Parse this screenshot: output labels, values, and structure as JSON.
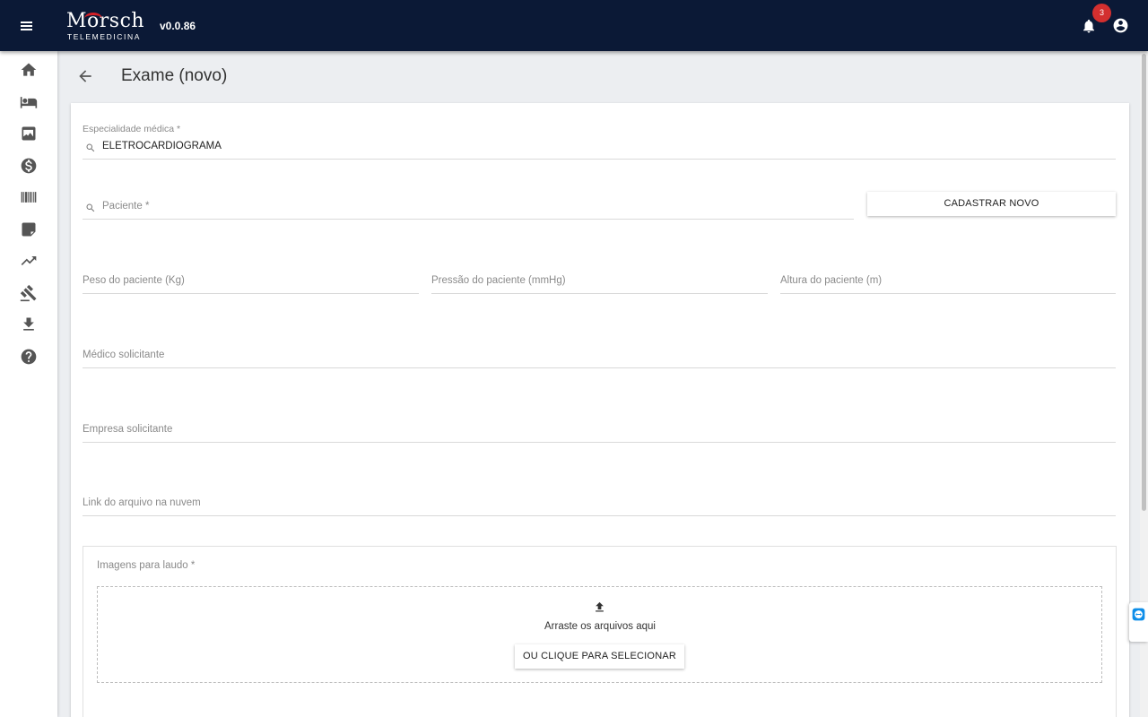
{
  "app": {
    "logo_text": "Morsch",
    "logo_subtext": "TELEMEDICINA",
    "version": "v0.0.86",
    "notification_count": "3",
    "colors": {
      "topbar": "#0b1936",
      "badge": "#d32f2f",
      "logo_accent": "#d42027"
    }
  },
  "sidebar": {
    "items": [
      {
        "icon": "home-icon"
      },
      {
        "icon": "hotel-bed-icon"
      },
      {
        "icon": "image-icon"
      },
      {
        "icon": "monetization-icon"
      },
      {
        "icon": "barcode-icon"
      },
      {
        "icon": "label-icon"
      },
      {
        "icon": "trending-up-icon"
      },
      {
        "icon": "gavel-icon"
      },
      {
        "icon": "download-icon"
      },
      {
        "icon": "help-icon"
      }
    ]
  },
  "page": {
    "title": "Exame (novo)"
  },
  "form": {
    "especialidade": {
      "label": "Especialidade médica *",
      "value": "ELETROCARDIOGRAMA"
    },
    "paciente": {
      "placeholder": "Paciente *"
    },
    "cadastrar_novo": "CADASTRAR NOVO",
    "peso": {
      "placeholder": "Peso do paciente (Kg)"
    },
    "pressao": {
      "placeholder": "Pressão do paciente (mmHg)"
    },
    "altura": {
      "placeholder": "Altura do paciente (m)"
    },
    "medico": {
      "placeholder": "Médico solicitante"
    },
    "empresa": {
      "placeholder": "Empresa solicitante"
    },
    "link": {
      "placeholder": "Link do arquivo na nuvem"
    },
    "imagens": {
      "label": "Imagens para laudo *",
      "drop_text": "Arraste os arquivos aqui",
      "select_button": "OU CLIQUE PARA SELECIONAR"
    }
  }
}
